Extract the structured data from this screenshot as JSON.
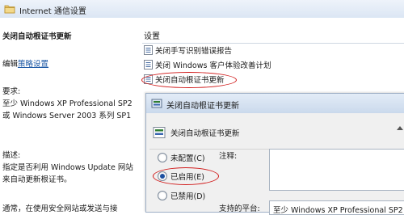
{
  "window": {
    "title": "Internet 通信设置"
  },
  "left_pane": {
    "title": "关闭自动根证书更新",
    "edit_prefix": "编辑",
    "edit_link": "策略设置",
    "requirements_label": "要求:",
    "requirements_body": "至少 Windows XP Professional SP2 或 Windows Server 2003 系列 SP1",
    "description_label": "描述:",
    "description_body": "指定是否利用 Windows Update 网站来自动更新根证书。",
    "note": "通常，在使用安全网站或发送与接"
  },
  "settings_list": {
    "header": "设置",
    "rows": [
      {
        "label": "关闭手写识别错误报告"
      },
      {
        "label": "关闭 Windows 客户体验改善计划"
      },
      {
        "label": "关闭自动根证书更新"
      }
    ]
  },
  "dialog": {
    "title": "关闭自动根证书更新",
    "setting_name": "关闭自动根证书更新",
    "options": [
      {
        "label": "未配置(C)",
        "selected": false
      },
      {
        "label": "已启用(E)",
        "selected": true
      },
      {
        "label": "已禁用(D)",
        "selected": false
      }
    ],
    "comment_label": "注释:",
    "supported_label": "支持的平台:",
    "supported_value": "至少 Windows XP Professional SP2"
  },
  "colors": {
    "highlight_ellipse": "#d01818",
    "link": "#1f5aa6"
  }
}
